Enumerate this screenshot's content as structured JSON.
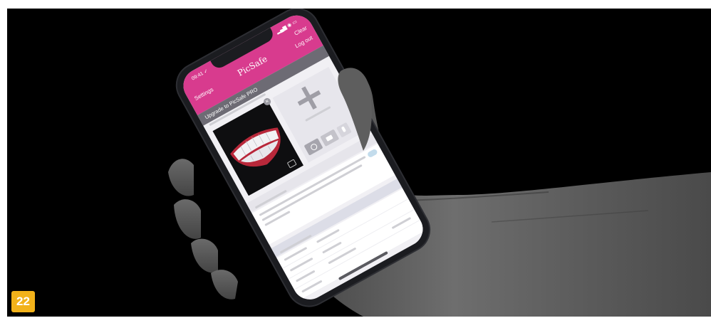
{
  "badge": {
    "label": "22",
    "color": "#f2b21a"
  },
  "app": {
    "status_time": "09:41 ✓",
    "status_icons": "▂▄▆ ◉ ▭",
    "nav_left": "Settings",
    "title": "PicSafe",
    "nav_right_top": "Clear",
    "nav_right_bottom": "Log out",
    "upgrade_banner": "Upgrade to PicSafe PRO",
    "accent_color": "#d83b8e"
  },
  "icons": [
    "plus-icon",
    "camera-icon",
    "video-icon",
    "microphone-icon",
    "remove-icon"
  ]
}
